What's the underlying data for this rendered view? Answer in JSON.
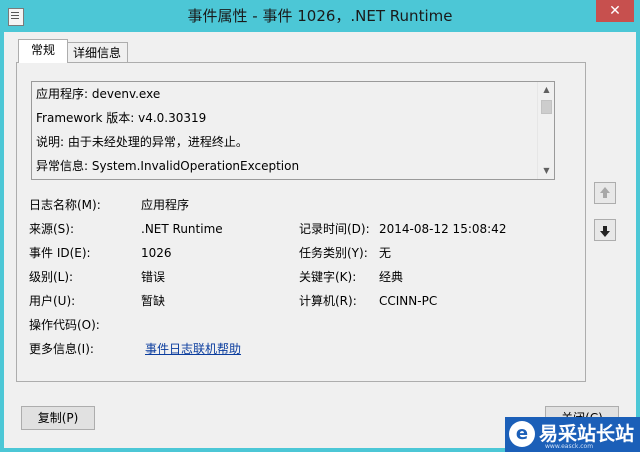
{
  "window": {
    "title": "事件属性 - 事件 1026，.NET Runtime",
    "close_glyph": "✕"
  },
  "tabs": {
    "general": "常规",
    "details": "详细信息"
  },
  "description": {
    "lines": [
      "应用程序: devenv.exe",
      "Framework 版本: v4.0.30319",
      "说明: 由于未经处理的异常，进程终止。",
      "异常信息: System.InvalidOperationException"
    ]
  },
  "fields": {
    "log_name": {
      "label": "日志名称(M):",
      "value": "应用程序"
    },
    "source": {
      "label": "来源(S):",
      "value": ".NET Runtime"
    },
    "logged": {
      "label": "记录时间(D):",
      "value": "2014-08-12 15:08:42"
    },
    "event_id": {
      "label": "事件 ID(E):",
      "value": "1026"
    },
    "task_category": {
      "label": "任务类别(Y):",
      "value": "无"
    },
    "level": {
      "label": "级别(L):",
      "value": "错误"
    },
    "keywords": {
      "label": "关键字(K):",
      "value": "经典"
    },
    "user": {
      "label": "用户(U):",
      "value": "暂缺"
    },
    "computer": {
      "label": "计算机(R):",
      "value": "CCINN-PC"
    },
    "opcode": {
      "label": "操作代码(O):",
      "value": ""
    },
    "more_info": {
      "label": "更多信息(I):",
      "link": "事件日志联机帮助"
    }
  },
  "buttons": {
    "copy": "复制(P)",
    "close": "关闭(C)"
  },
  "watermark": {
    "text": "易采站长站",
    "url": "www.easck.com"
  },
  "colors": {
    "titlebar": "#4cc7d6",
    "close_button": "#c7504e",
    "link": "#0b3d9e",
    "watermark": "#1b5fb8"
  },
  "icons": {
    "window": "event-properties-icon",
    "previous": "arrow-up-icon",
    "next": "arrow-down-icon"
  }
}
